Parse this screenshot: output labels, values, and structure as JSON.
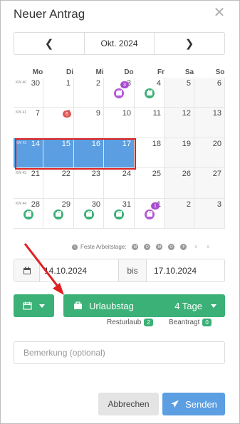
{
  "dialog": {
    "title": "Neuer Antrag",
    "close_icon": "close-icon"
  },
  "nav": {
    "month": "Okt. 2024",
    "prev_icon": "chevron-left-icon",
    "next_icon": "chevron-right-icon"
  },
  "weekdays": [
    "Mo",
    "Di",
    "Mi",
    "Do",
    "Fr",
    "Sa",
    "So"
  ],
  "weeks": [
    {
      "kw": "KW 40",
      "days": [
        "30",
        "1",
        "2",
        "3",
        "4",
        "5",
        "6"
      ]
    },
    {
      "kw": "KW 41",
      "days": [
        "7",
        "8",
        "9",
        "10",
        "11",
        "12",
        "13"
      ]
    },
    {
      "kw": "KW 42",
      "days": [
        "14",
        "15",
        "16",
        "17",
        "18",
        "19",
        "20"
      ]
    },
    {
      "kw": "KW 43",
      "days": [
        "21",
        "22",
        "23",
        "24",
        "25",
        "26",
        "27"
      ]
    },
    {
      "kw": "KW 44",
      "days": [
        "28",
        "29",
        "30",
        "31",
        "1",
        "2",
        "3"
      ]
    }
  ],
  "badges": {
    "count_3": "3",
    "count_6": "6",
    "count_1": "1"
  },
  "workdays": {
    "label": "Feste Arbeitstage:",
    "days": [
      "M",
      "D",
      "M",
      "D",
      "F",
      "S",
      "S"
    ]
  },
  "dates": {
    "from": "14.10.2024",
    "separator": "bis",
    "to": "17.10.2024"
  },
  "leave": {
    "type": "Urlaubstag",
    "days": "4 Tage"
  },
  "stats": {
    "rest_label": "Resturlaub",
    "rest_value": "2",
    "requested_label": "Beantragt",
    "requested_value": "0"
  },
  "remark": {
    "placeholder": "Bemerkung (optional)"
  },
  "buttons": {
    "cancel": "Abbrechen",
    "send": "Senden"
  },
  "colors": {
    "green": "#3bb077",
    "blue": "#5b9ee1",
    "purple": "#b15ad6",
    "red": "#e05656",
    "highlight": "#e02020"
  }
}
